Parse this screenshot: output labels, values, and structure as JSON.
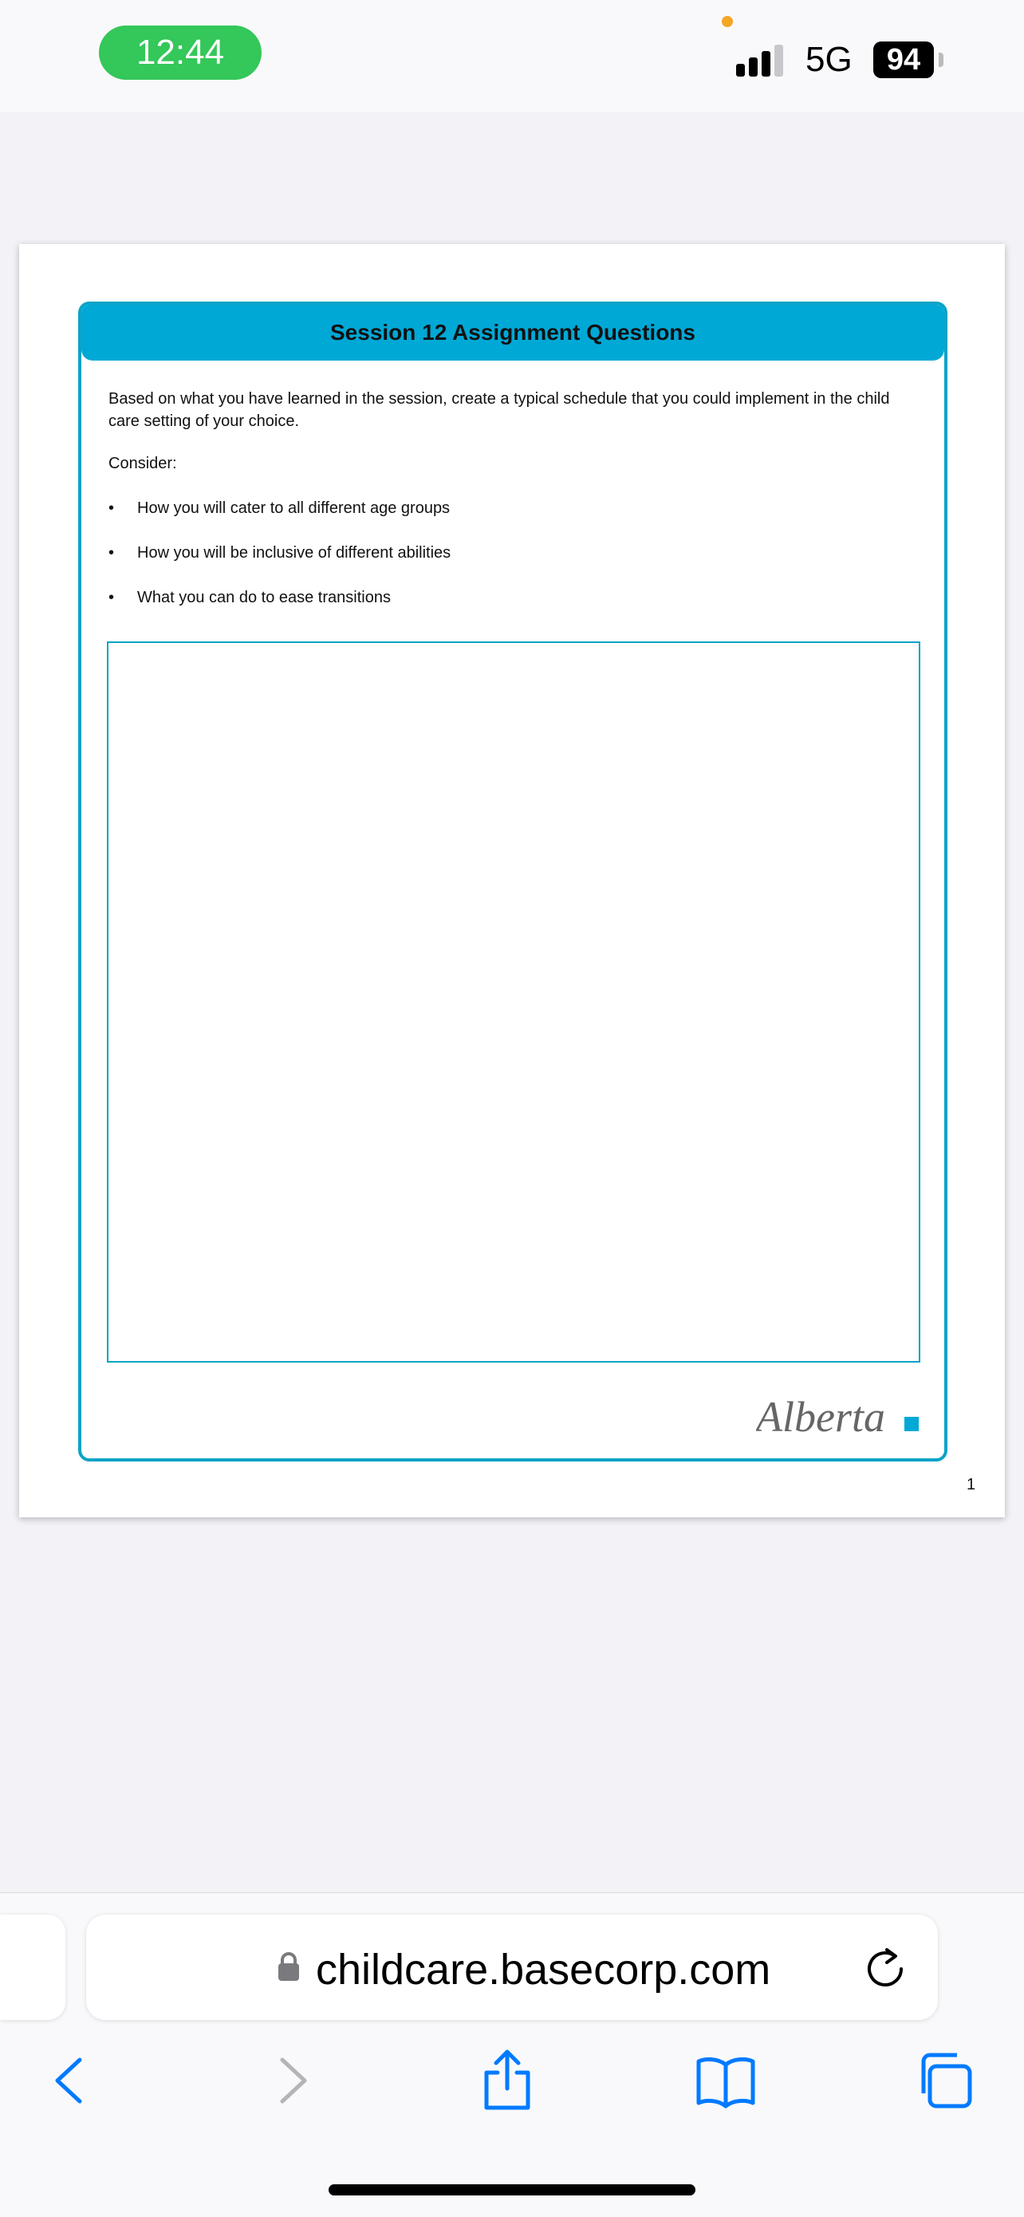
{
  "status_bar": {
    "time": "12:44",
    "network": "5G",
    "battery": "94"
  },
  "document": {
    "title": "Session 12 Assignment Questions",
    "intro": "Based on what you have learned in the session, create a typical schedule that you could implement in the child care setting of your choice.",
    "consider_label": "Consider:",
    "bullets": [
      "How you will cater to all different age groups",
      "How you will be inclusive of different abilities",
      "What you can do to ease transitions"
    ],
    "bullet_symbol": "•",
    "logo_text": "Alberta",
    "page_number": "1",
    "accent_color": "#00a8d6"
  },
  "browser": {
    "url": "childcare.basecorp.com"
  }
}
